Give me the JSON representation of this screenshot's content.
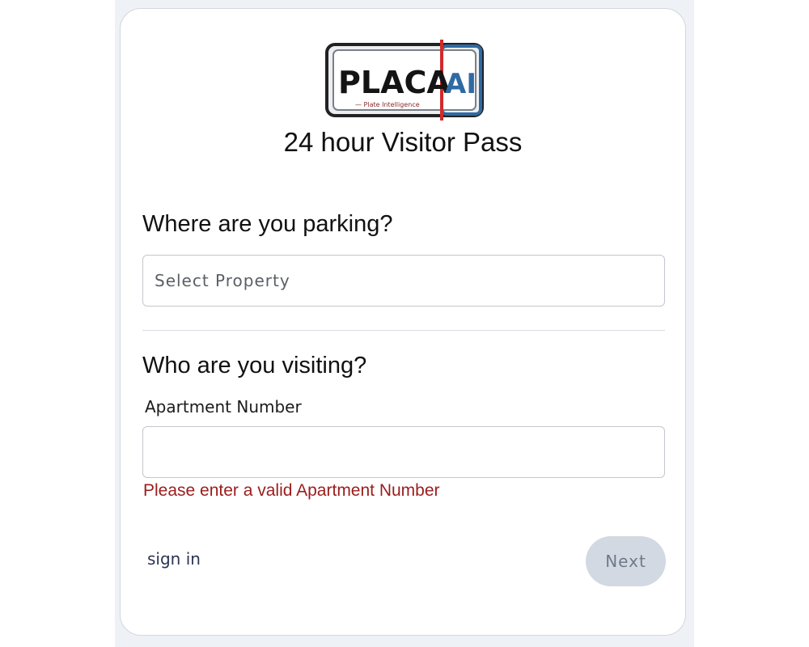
{
  "logo": {
    "brand_left": "PLACA",
    "brand_right": "AI",
    "tagline": "— Plate Intelligence"
  },
  "page": {
    "title": "24 hour Visitor Pass"
  },
  "parking": {
    "heading": "Where are you parking?",
    "select_value": "Select Property"
  },
  "visiting": {
    "heading": "Who are you visiting?",
    "apartment_label": "Apartment Number",
    "apartment_value": "",
    "error": "Please enter a valid Apartment Number"
  },
  "footer": {
    "signin_label": "sign in",
    "next_label": "Next"
  },
  "colors": {
    "error": "#9b1c1c",
    "button_disabled_bg": "#d3d9e2",
    "logo_accent_blue": "#2f6aa3",
    "logo_accent_red": "#d12a2a"
  }
}
